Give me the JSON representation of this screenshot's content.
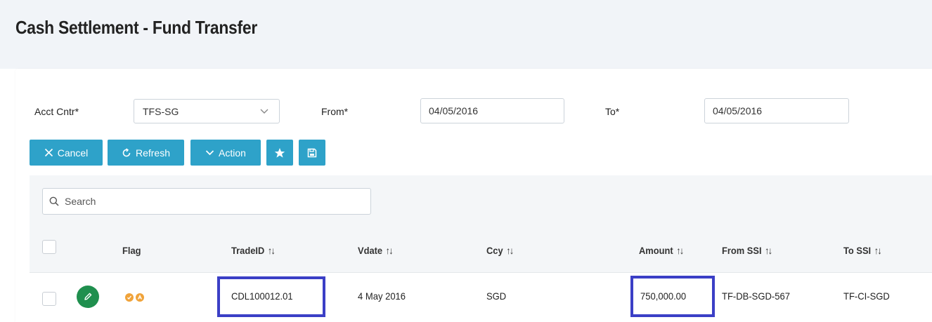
{
  "page": {
    "title": "Cash Settlement - Fund Transfer"
  },
  "filters": {
    "acct_cntr_label": "Acct Cntr*",
    "acct_cntr_value": "TFS-SG",
    "from_label": "From*",
    "from_value": "04/05/2016",
    "to_label": "To*",
    "to_value": "04/05/2016"
  },
  "toolbar": {
    "cancel_label": "Cancel",
    "refresh_label": "Refresh",
    "action_label": "Action"
  },
  "search": {
    "placeholder": "Search"
  },
  "table": {
    "columns": {
      "flag": "Flag",
      "trade_id": "TradeID",
      "vdate": "Vdate",
      "ccy": "Ccy",
      "amount": "Amount",
      "from_ssi": "From SSI",
      "to_ssi": "To SSI"
    },
    "rows": [
      {
        "trade_id": "CDL100012.01",
        "vdate": "4 May 2016",
        "ccy": "SGD",
        "amount": "750,000.00",
        "from_ssi": "TF-DB-SGD-567",
        "to_ssi": "TF-CI-SGD"
      }
    ]
  },
  "colors": {
    "primary": "#2ea2c9",
    "edit_button": "#1f8f4e",
    "flag": "#f0a33a",
    "highlight": "#3b3fc6"
  }
}
